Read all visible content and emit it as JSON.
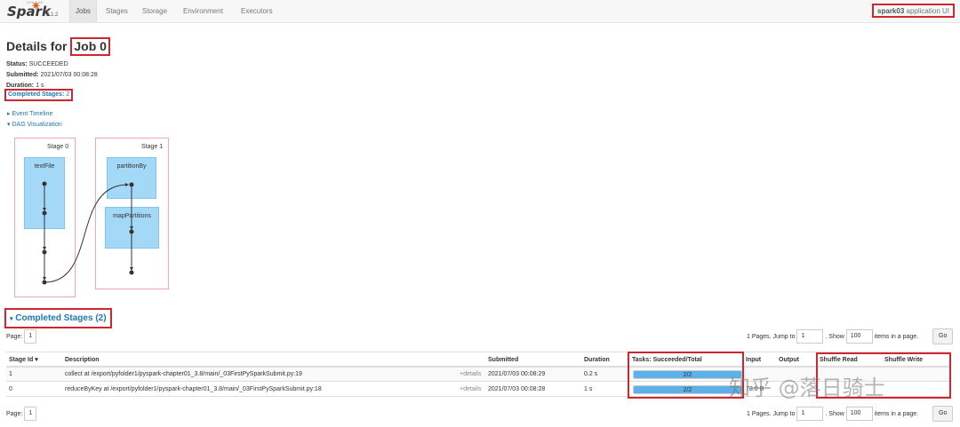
{
  "nav": {
    "logo": "Spark",
    "version": "3.1.2",
    "tabs": [
      "Jobs",
      "Stages",
      "Storage",
      "Environment",
      "Executors"
    ],
    "active_tab": "Jobs",
    "app_name": "spark03",
    "app_suffix": "application UI"
  },
  "job": {
    "title_prefix": "Details for",
    "title_id": "Job 0",
    "status_label": "Status:",
    "status_value": "SUCCEEDED",
    "submitted_label": "Submitted:",
    "submitted_value": "2021/07/03 00:08:28",
    "duration_label": "Duration:",
    "duration_value": "1 s",
    "completed_label": "Completed Stages:",
    "completed_value": "2"
  },
  "toggles": {
    "event_timeline": "Event Timeline",
    "dag_visualization": "DAG Visualization"
  },
  "dag": {
    "stage0": {
      "label": "Stage 0",
      "rdd": "textFile"
    },
    "stage1": {
      "label": "Stage 1",
      "rdd1": "partitionBy",
      "rdd2": "mapPartitions"
    }
  },
  "completed_section": {
    "title": "Completed Stages (2)",
    "page_label": "Page:",
    "page_value": "1",
    "pages_text": "1 Pages. Jump to",
    "jump_value": "1",
    "show_label": ". Show",
    "show_value": "100",
    "items_label": "items in a page.",
    "go_label": "Go"
  },
  "table": {
    "headers": {
      "stage_id": "Stage Id",
      "sort_indicator": "▾",
      "description": "Description",
      "submitted": "Submitted",
      "duration": "Duration",
      "tasks": "Tasks: Succeeded/Total",
      "input": "Input",
      "output": "Output",
      "shuffle_read": "Shuffle Read",
      "shuffle_write": "Shuffle Write"
    },
    "rows": [
      {
        "stage_id": "1",
        "description": "collect at /export/pyfolder1/pyspark-chapter01_3.8/main/_03FirstPySparkSubmit.py:19",
        "details": "+details",
        "submitted": "2021/07/03 00:08:29",
        "duration": "0.2 s",
        "tasks": "2/2",
        "tasks_fraction": 1.0,
        "input": "",
        "output": "",
        "shuffle_read": "",
        "shuffle_write": ""
      },
      {
        "stage_id": "0",
        "description": "reduceByKey at /export/pyfolder1/pyspark-chapter01_3.8/main/_03FirstPySparkSubmit.py:18",
        "details": "+details",
        "submitted": "2021/07/03 00:08:28",
        "duration": "1 s",
        "tasks": "2/2",
        "tasks_fraction": 1.0,
        "input": "78.0 B",
        "output": "",
        "shuffle_read": "",
        "shuffle_write": ""
      }
    ]
  },
  "watermark": "知乎 @落日骑士"
}
